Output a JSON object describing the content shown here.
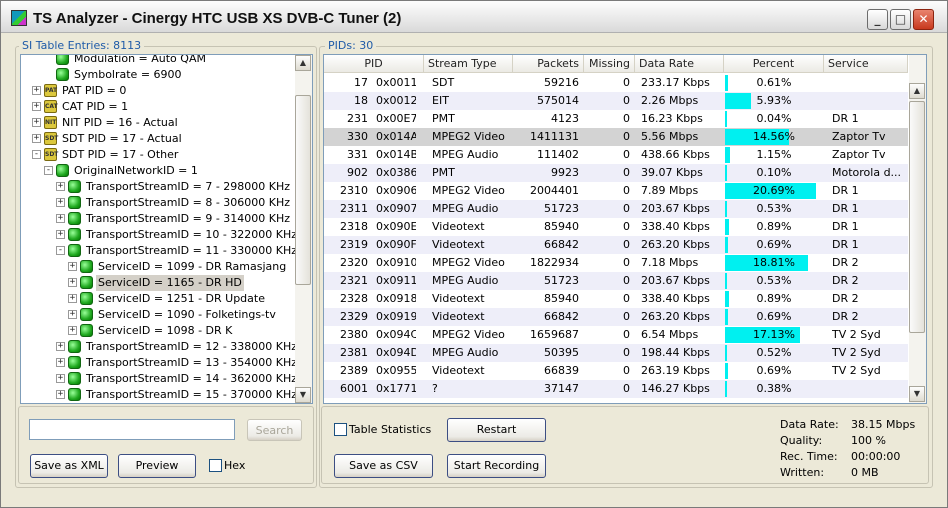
{
  "window": {
    "title": "TS Analyzer - Cinergy HTC USB XS DVB-C Tuner (2)",
    "min": "_",
    "max": "□",
    "close": "✕"
  },
  "left_panel": {
    "label": "SI Table Entries: 8113",
    "tree": [
      {
        "label": "Modulation = Auto QAM",
        "icon": "green-dot"
      },
      {
        "label": "Symbolrate = 6900",
        "icon": "green-dot"
      },
      {
        "label": "PAT PID = 0",
        "icon": "pat-table-icon",
        "badge": "PAT"
      },
      {
        "label": "CAT PID = 1",
        "icon": "cat-table-icon",
        "badge": "CAT"
      },
      {
        "label": "NIT PID = 16 - Actual",
        "icon": "nit-table-icon",
        "badge": "NIT"
      },
      {
        "label": "SDT PID = 17 - Actual",
        "icon": "sdt-table-icon",
        "badge": "SDT"
      },
      {
        "label": "SDT PID = 17 - Other",
        "icon": "sdt-table-icon",
        "badge": "SDT"
      },
      {
        "label": "OriginalNetworkID = 1",
        "icon": "green-dot"
      },
      {
        "label": "TransportStreamID = 7 - 298000 KHz",
        "icon": "green-dot"
      },
      {
        "label": "TransportStreamID = 8 - 306000 KHz",
        "icon": "green-dot"
      },
      {
        "label": "TransportStreamID = 9 - 314000 KHz",
        "icon": "green-dot"
      },
      {
        "label": "TransportStreamID = 10 - 322000 KHz",
        "icon": "green-dot"
      },
      {
        "label": "TransportStreamID = 11 - 330000 KHz",
        "icon": "green-dot"
      },
      {
        "label": "ServiceID = 1099 - DR Ramasjang",
        "icon": "green-dot"
      },
      {
        "label": "ServiceID = 1165 - DR HD",
        "icon": "green-dot",
        "selected": true
      },
      {
        "label": "ServiceID = 1251 - DR Update",
        "icon": "green-dot"
      },
      {
        "label": "ServiceID = 1090 - Folketings-tv",
        "icon": "green-dot"
      },
      {
        "label": "ServiceID = 1098 - DR K",
        "icon": "green-dot"
      },
      {
        "label": "TransportStreamID = 12 - 338000 KHz",
        "icon": "green-dot"
      },
      {
        "label": "TransportStreamID = 13 - 354000 KHz",
        "icon": "green-dot"
      },
      {
        "label": "TransportStreamID = 14 - 362000 KHz",
        "icon": "green-dot"
      },
      {
        "label": "TransportStreamID = 15 - 370000 KHz",
        "icon": "green-dot"
      }
    ],
    "search_value": "",
    "search_button": "Search",
    "save_xml": "Save as XML",
    "preview": "Preview",
    "hex_label": "Hex"
  },
  "right_panel": {
    "label": "PIDs: 30",
    "columns": [
      "PID",
      "Stream Type",
      "Packets",
      "Missing",
      "Data Rate",
      "Percent",
      "Service"
    ],
    "rows": [
      {
        "pid": "17",
        "hex": "0x0011",
        "type": "SDT",
        "packets": "59216",
        "missing": "0",
        "rate": "233.17 Kbps",
        "percent": "0.61%",
        "pct": 0.61,
        "service": ""
      },
      {
        "pid": "18",
        "hex": "0x0012",
        "type": "EIT",
        "packets": "575014",
        "missing": "0",
        "rate": "2.26 Mbps",
        "percent": "5.93%",
        "pct": 5.93,
        "service": ""
      },
      {
        "pid": "231",
        "hex": "0x00E7",
        "type": "PMT",
        "packets": "4123",
        "missing": "0",
        "rate": "16.23 Kbps",
        "percent": "0.04%",
        "pct": 0.04,
        "service": "DR 1"
      },
      {
        "pid": "330",
        "hex": "0x014A",
        "type": "MPEG2 Video",
        "packets": "1411131",
        "missing": "0",
        "rate": "5.56 Mbps",
        "percent": "14.56%",
        "pct": 14.56,
        "service": "Zaptor Tv",
        "highlight": true
      },
      {
        "pid": "331",
        "hex": "0x014B",
        "type": "MPEG Audio",
        "packets": "111402",
        "missing": "0",
        "rate": "438.66 Kbps",
        "percent": "1.15%",
        "pct": 1.15,
        "service": "Zaptor Tv"
      },
      {
        "pid": "902",
        "hex": "0x0386",
        "type": "PMT",
        "packets": "9923",
        "missing": "0",
        "rate": "39.07 Kbps",
        "percent": "0.10%",
        "pct": 0.1,
        "service": "Motorola d..."
      },
      {
        "pid": "2310",
        "hex": "0x0906",
        "type": "MPEG2 Video",
        "packets": "2004401",
        "missing": "0",
        "rate": "7.89 Mbps",
        "percent": "20.69%",
        "pct": 20.69,
        "service": "DR 1"
      },
      {
        "pid": "2311",
        "hex": "0x0907",
        "type": "MPEG Audio",
        "packets": "51723",
        "missing": "0",
        "rate": "203.67 Kbps",
        "percent": "0.53%",
        "pct": 0.53,
        "service": "DR 1"
      },
      {
        "pid": "2318",
        "hex": "0x090E",
        "type": "Videotext",
        "packets": "85940",
        "missing": "0",
        "rate": "338.40 Kbps",
        "percent": "0.89%",
        "pct": 0.89,
        "service": "DR 1"
      },
      {
        "pid": "2319",
        "hex": "0x090F",
        "type": "Videotext",
        "packets": "66842",
        "missing": "0",
        "rate": "263.20 Kbps",
        "percent": "0.69%",
        "pct": 0.69,
        "service": "DR 1"
      },
      {
        "pid": "2320",
        "hex": "0x0910",
        "type": "MPEG2 Video",
        "packets": "1822934",
        "missing": "0",
        "rate": "7.18 Mbps",
        "percent": "18.81%",
        "pct": 18.81,
        "service": "DR 2"
      },
      {
        "pid": "2321",
        "hex": "0x0911",
        "type": "MPEG Audio",
        "packets": "51723",
        "missing": "0",
        "rate": "203.67 Kbps",
        "percent": "0.53%",
        "pct": 0.53,
        "service": "DR 2"
      },
      {
        "pid": "2328",
        "hex": "0x0918",
        "type": "Videotext",
        "packets": "85940",
        "missing": "0",
        "rate": "338.40 Kbps",
        "percent": "0.89%",
        "pct": 0.89,
        "service": "DR 2"
      },
      {
        "pid": "2329",
        "hex": "0x0919",
        "type": "Videotext",
        "packets": "66842",
        "missing": "0",
        "rate": "263.20 Kbps",
        "percent": "0.69%",
        "pct": 0.69,
        "service": "DR 2"
      },
      {
        "pid": "2380",
        "hex": "0x094C",
        "type": "MPEG2 Video",
        "packets": "1659687",
        "missing": "0",
        "rate": "6.54 Mbps",
        "percent": "17.13%",
        "pct": 17.13,
        "service": "TV 2 Syd"
      },
      {
        "pid": "2381",
        "hex": "0x094D",
        "type": "MPEG Audio",
        "packets": "50395",
        "missing": "0",
        "rate": "198.44 Kbps",
        "percent": "0.52%",
        "pct": 0.52,
        "service": "TV 2 Syd"
      },
      {
        "pid": "2389",
        "hex": "0x0955",
        "type": "Videotext",
        "packets": "66839",
        "missing": "0",
        "rate": "263.19 Kbps",
        "percent": "0.69%",
        "pct": 0.69,
        "service": "TV 2 Syd"
      },
      {
        "pid": "6001",
        "hex": "0x1771",
        "type": "?",
        "packets": "37147",
        "missing": "0",
        "rate": "146.27 Kbps",
        "percent": "0.38%",
        "pct": 0.38,
        "service": ""
      }
    ],
    "table_stats": "Table Statistics",
    "restart": "Restart",
    "save_csv": "Save as CSV",
    "start_rec": "Start Recording",
    "stats": [
      {
        "label": "Data Rate:",
        "value": "38.15 Mbps"
      },
      {
        "label": "Quality:",
        "value": "100 %"
      },
      {
        "label": "Rec. Time:",
        "value": "00:00:00"
      },
      {
        "label": "Written:",
        "value": "0 MB"
      }
    ]
  },
  "colors": {
    "bar": "#00f0f0",
    "group_label": "#1f5ba8",
    "alt_row": "#eeeef9"
  }
}
